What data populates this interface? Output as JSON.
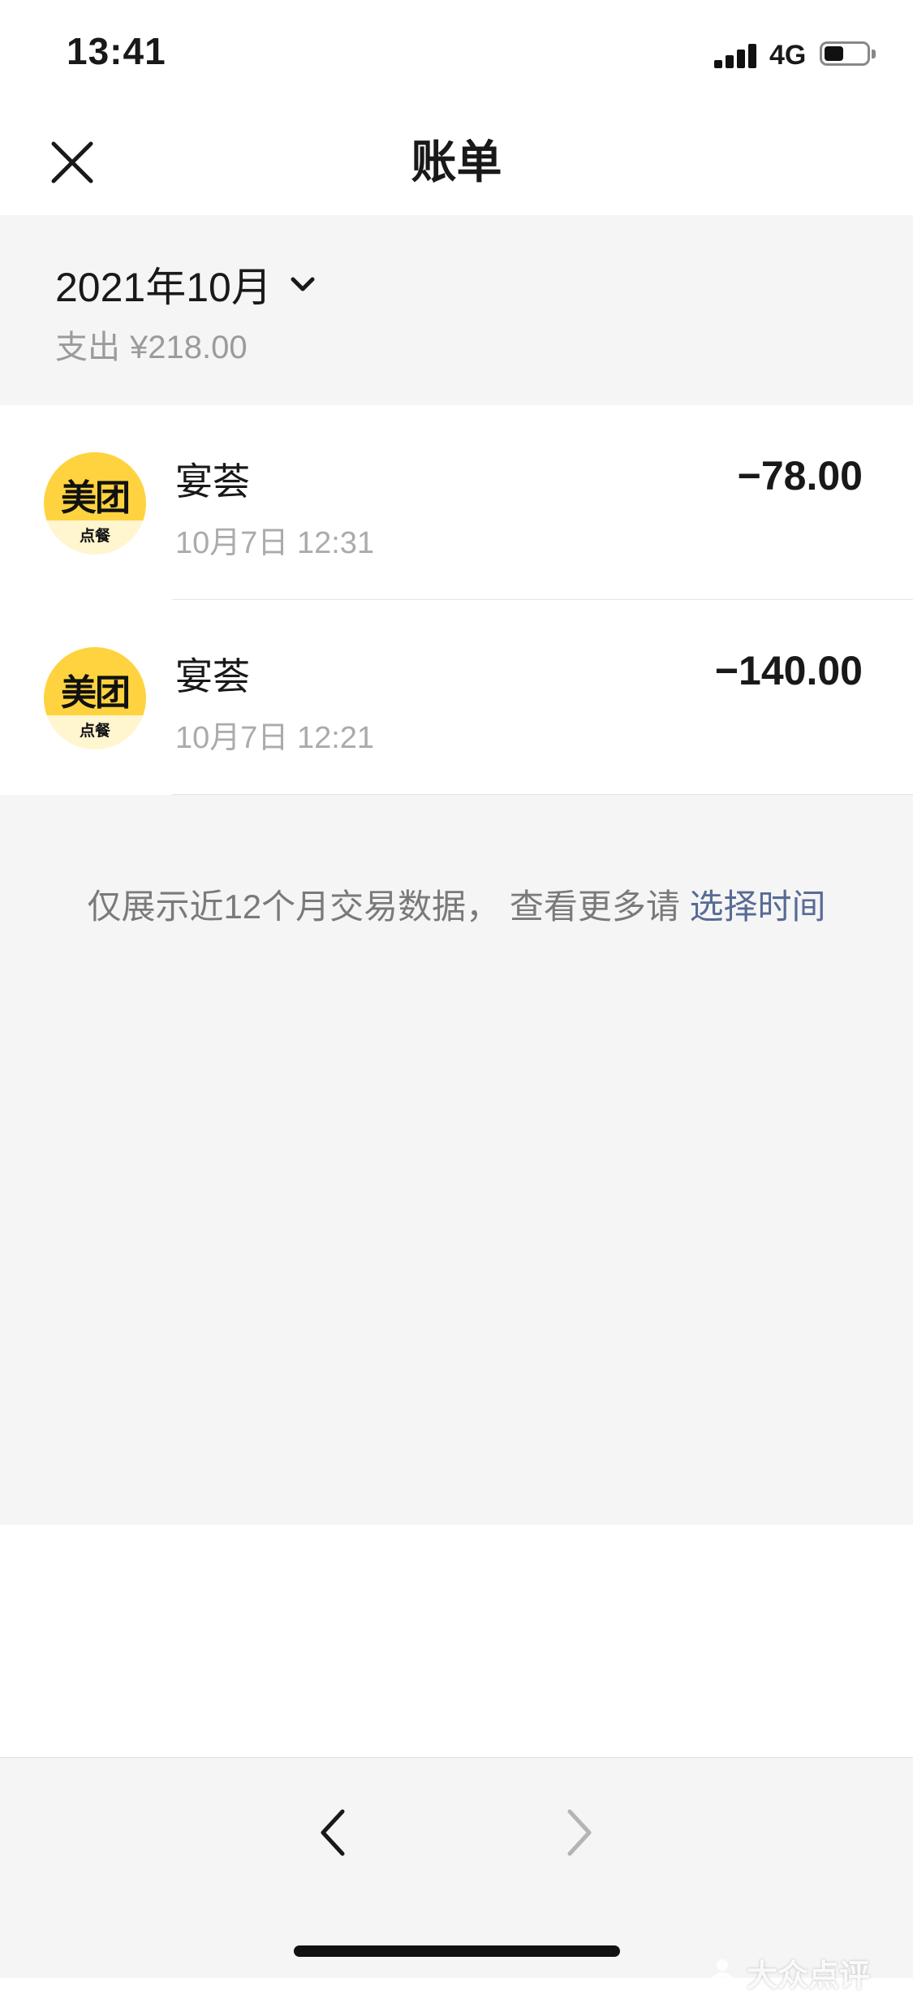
{
  "status_bar": {
    "time": "13:41",
    "network": "4G",
    "battery_level": 0.45
  },
  "nav": {
    "title": "账单",
    "close_icon": "close-icon"
  },
  "month_header": {
    "month": "2021年10月",
    "chevron_icon": "chevron-down-icon",
    "expense_label": "支出",
    "expense_amount": "¥218.00"
  },
  "transactions": [
    {
      "logo_brand": "美团",
      "logo_sub": "点餐",
      "merchant": "宴荟",
      "time": "10月7日 12:31",
      "amount": "−78.00"
    },
    {
      "logo_brand": "美团",
      "logo_sub": "点餐",
      "merchant": "宴荟",
      "time": "10月7日 12:21",
      "amount": "−140.00"
    }
  ],
  "footer_note": {
    "text": "仅展示近12个月交易数据， 查看更多请",
    "link": "选择时间"
  },
  "toolbar": {
    "back_icon": "chevron-left-icon",
    "forward_icon": "chevron-right-icon"
  },
  "watermark": {
    "text": "大众点评"
  },
  "colors": {
    "background_gray": "#f5f5f5",
    "link_blue": "#576b95",
    "meituan_yellow": "#ffd33f"
  }
}
